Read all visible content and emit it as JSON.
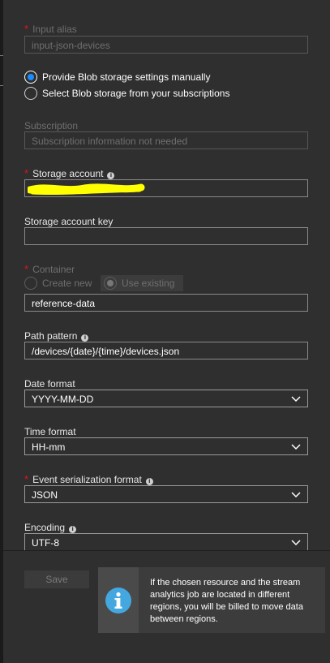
{
  "form": {
    "input_alias": {
      "label": "Input alias",
      "placeholder": "input-json-devices"
    },
    "source_options": [
      {
        "label": "Provide Blob storage settings manually",
        "selected": true
      },
      {
        "label": "Select Blob storage from your subscriptions",
        "selected": false
      }
    ],
    "subscription": {
      "label": "Subscription",
      "value": "Subscription information not needed"
    },
    "storage_account": {
      "label": "Storage account",
      "value": ""
    },
    "storage_account_key": {
      "label": "Storage account key",
      "value": ""
    },
    "container": {
      "label": "Container",
      "options": [
        "Create new",
        "Use existing"
      ],
      "selected": "Use existing",
      "value": "reference-data"
    },
    "path_pattern": {
      "label": "Path pattern",
      "value": "/devices/{date}/{time}/devices.json"
    },
    "date_format": {
      "label": "Date format",
      "value": "YYYY-MM-DD"
    },
    "time_format": {
      "label": "Time format",
      "value": "HH-mm"
    },
    "event_serialization_format": {
      "label": "Event serialization format",
      "value": "JSON"
    },
    "encoding": {
      "label": "Encoding",
      "value": "UTF-8"
    }
  },
  "footer": {
    "save_label": "Save",
    "notice": "If the chosen resource and the stream analytics job are located in different regions, you will be billed to move data between regions."
  },
  "colors": {
    "panel_bg": "#2f2f2f",
    "accent": "#1a8cff",
    "required": "#e81123",
    "redaction": "#ffff00",
    "info_icon": "#45a7e0"
  },
  "icons": {
    "required_marker": "*",
    "info": "info-icon",
    "dropdown": "chevron-down-icon",
    "notice": "info-circle-icon"
  }
}
